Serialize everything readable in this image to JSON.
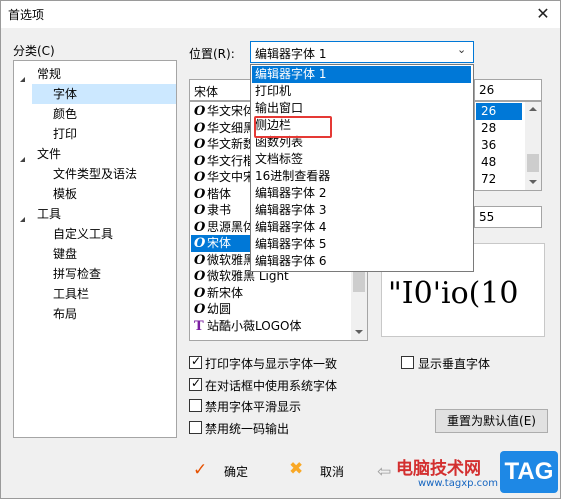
{
  "window": {
    "title": "首选项",
    "close_glyph": "✕"
  },
  "category": {
    "label": "分类(C)",
    "items": [
      {
        "label": "常规",
        "level": 0,
        "expanded": true
      },
      {
        "label": "字体",
        "level": 1,
        "selected": true
      },
      {
        "label": "颜色",
        "level": 1
      },
      {
        "label": "打印",
        "level": 1
      },
      {
        "label": "文件",
        "level": 0,
        "expanded": true
      },
      {
        "label": "文件类型及语法",
        "level": 1
      },
      {
        "label": "模板",
        "level": 1
      },
      {
        "label": "工具",
        "level": 0,
        "expanded": true
      },
      {
        "label": "自定义工具",
        "level": 1
      },
      {
        "label": "键盘",
        "level": 1
      },
      {
        "label": "拼写检查",
        "level": 1
      },
      {
        "label": "工具栏",
        "level": 1
      },
      {
        "label": "布局",
        "level": 1
      }
    ]
  },
  "position": {
    "label": "位置(R):",
    "selected": "编辑器字体 1",
    "options": [
      "编辑器字体 1",
      "打印机",
      "输出窗口",
      "侧边栏",
      "函数列表",
      "文档标签",
      "16进制查看器",
      "编辑器字体 2",
      "编辑器字体 3",
      "编辑器字体 4",
      "编辑器字体 5",
      "编辑器字体 6"
    ],
    "highlighted_option": "侧边栏"
  },
  "font": {
    "current": "宋体",
    "list": [
      {
        "name": "华文宋体",
        "icon": "O"
      },
      {
        "name": "华文细黑",
        "icon": "O"
      },
      {
        "name": "华文新魏",
        "icon": "O"
      },
      {
        "name": "华文行楷",
        "icon": "O"
      },
      {
        "name": "华文中宋",
        "icon": "O"
      },
      {
        "name": "楷体",
        "icon": "O"
      },
      {
        "name": "隶书",
        "icon": "O"
      },
      {
        "name": "思源黑体",
        "icon": "O"
      },
      {
        "name": "宋体",
        "icon": "O",
        "selected": true
      },
      {
        "name": "微软雅黑",
        "icon": "O"
      },
      {
        "name": "微软雅黑 Light",
        "icon": "O"
      },
      {
        "name": "新宋体",
        "icon": "O"
      },
      {
        "name": "幼圆",
        "icon": "O"
      },
      {
        "name": "站酷小薇LOGO体",
        "icon": "T"
      }
    ]
  },
  "size": {
    "current": "26",
    "list": [
      "26",
      "28",
      "36",
      "48",
      "72"
    ],
    "selected": "26",
    "second_value": "55"
  },
  "preview_text": "\"I0'io(10",
  "options": [
    {
      "label": "打印字体与显示字体一致",
      "checked": true
    },
    {
      "label": "在对话框中使用系统字体",
      "checked": true
    },
    {
      "label": "禁用字体平滑显示",
      "checked": false
    },
    {
      "label": "禁用统一码输出",
      "checked": false
    }
  ],
  "show_vertical": {
    "label": "显示垂直字体",
    "checked": false
  },
  "buttons": {
    "reset": "重置为默认值(E)",
    "ok": "确定",
    "cancel": "取消"
  },
  "watermark": {
    "site_name": "电脑技术网",
    "url": "www.tagxp.com",
    "tag": "TAG"
  },
  "colors": {
    "selection": "#0078d7",
    "highlight_box": "#e53935",
    "tag_bg": "#1e88e5"
  }
}
